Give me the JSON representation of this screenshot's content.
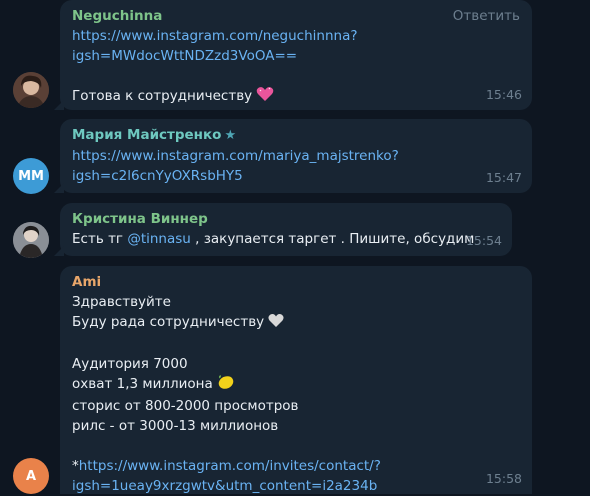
{
  "messages": [
    {
      "sender": "Neguchinna",
      "sender_color": "#7ec48a",
      "reply_label": "Ответить",
      "link_line1": "https://www.instagram.com/neguchinnna?",
      "link_line2": "igsh=MWdocWttNDZzd3VoOA==",
      "text": "Готова к сотрудничеству",
      "emoji": "heart-sparkle-icon",
      "time": "15:46"
    },
    {
      "sender": "Мария Майстренко",
      "sender_color": "#6ec9c0",
      "avatar_initials": "ММ",
      "avatar_color": "#3d9bd6",
      "link_line1": "https://www.instagram.com/mariya_majstrenko?",
      "link_line2": "igsh=c2l6cnYyOXRsbHY5",
      "time": "15:47"
    },
    {
      "sender": "Кристина Виннер",
      "sender_color": "#7ec48a",
      "text_before": "Есть тг ",
      "mention": "@tinnasu",
      "text_after": " , закупается таргет . Пишите, обсудим",
      "time": "15:54"
    },
    {
      "sender": "Ami",
      "sender_color": "#e8a66a",
      "avatar_initials": "A",
      "avatar_color": "#e9824a",
      "lines": [
        "Здравствуйте",
        "Буду рада сотрудничеству",
        "",
        "Аудитория 7000",
        "охват 1,3 миллиона",
        "сторис от 800-2000 просмотров",
        "рилс - от 3000-13 миллионов",
        ""
      ],
      "link_prefix": "*",
      "link_line1": "https://www.instagram.com/invites/contact/?",
      "link_line2": "igsh=1ueay9xrzgwtv&utm_content=i2a234b",
      "time": "15:58"
    }
  ]
}
